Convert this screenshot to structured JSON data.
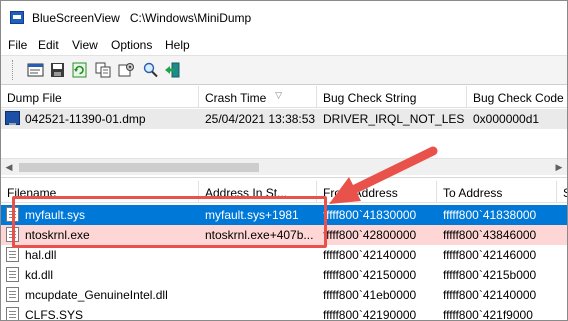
{
  "window": {
    "app_name": "BlueScreenView",
    "path": "C:\\Windows\\MiniDump"
  },
  "menu": [
    "File",
    "Edit",
    "View",
    "Options",
    "Help"
  ],
  "toolbar": {
    "buttons": [
      "properties-icon",
      "save-icon",
      "refresh-icon",
      "copy-icon",
      "options-icon",
      "find-icon",
      "exit-icon"
    ]
  },
  "dump_list": {
    "columns": [
      "Dump File",
      "Crash Time",
      "Bug Check String",
      "Bug Check Code"
    ],
    "rows": [
      {
        "dump_file": "042521-11390-01.dmp",
        "crash_time": "25/04/2021 13:38:53",
        "bug_check_string": "DRIVER_IRQL_NOT_LESS...",
        "bug_check_code": "0x000000d1"
      }
    ]
  },
  "driver_list": {
    "columns": [
      "Filename",
      "Address In St...",
      "From Address",
      "To Address"
    ],
    "rows": [
      {
        "filename": "myfault.sys",
        "address_in_stack": "myfault.sys+1981",
        "from_address": "fffff800`41830000",
        "to_address": "fffff800`41838000"
      },
      {
        "filename": "ntoskrnl.exe",
        "address_in_stack": "ntoskrnl.exe+407b...",
        "from_address": "fffff800`42800000",
        "to_address": "fffff800`43846000"
      },
      {
        "filename": "hal.dll",
        "address_in_stack": "",
        "from_address": "fffff800`42140000",
        "to_address": "fffff800`42146000"
      },
      {
        "filename": "kd.dll",
        "address_in_stack": "",
        "from_address": "fffff800`42150000",
        "to_address": "fffff800`4215b000"
      },
      {
        "filename": "mcupdate_GenuineIntel.dll",
        "address_in_stack": "",
        "from_address": "fffff800`41eb0000",
        "to_address": "fffff800`42140000"
      },
      {
        "filename": "CLFS.SYS",
        "address_in_stack": "",
        "from_address": "fffff800`42190000",
        "to_address": "fffff800`421f9000"
      }
    ]
  },
  "colors": {
    "selection": "#0078d7",
    "highlight_row": "#ffd6d6",
    "annotation": "#e8524a"
  }
}
